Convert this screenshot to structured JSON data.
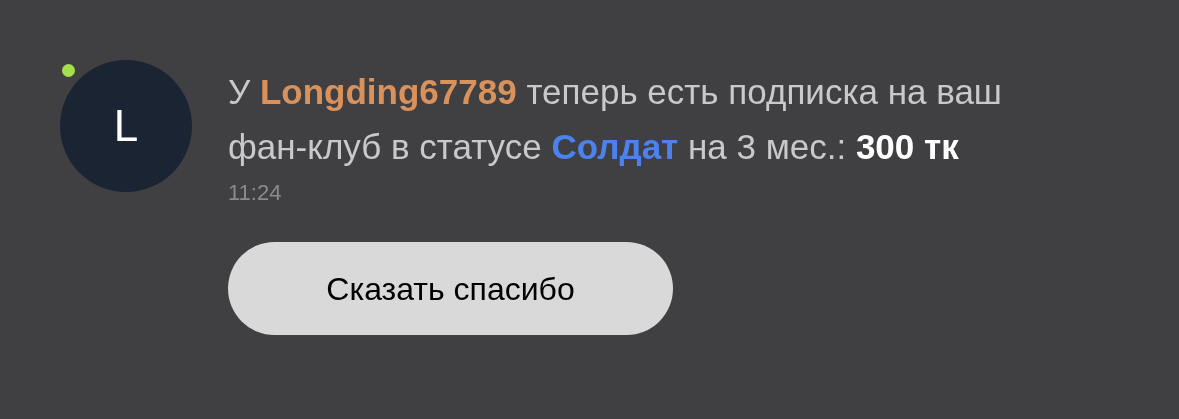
{
  "notification": {
    "avatar": {
      "letter": "L",
      "online": true
    },
    "message": [
      {
        "kind": "text",
        "text": "У "
      },
      {
        "kind": "username",
        "text": "Longding67789"
      },
      {
        "kind": "text",
        "text": " теперь есть подписка на ваш фан-клуб в статусе "
      },
      {
        "kind": "tier",
        "text": "Солдат"
      },
      {
        "kind": "text",
        "text": " на 3 мес.: "
      },
      {
        "kind": "amount",
        "text": "300 тк"
      }
    ],
    "time": "11:24",
    "button": "Сказать спасибо"
  }
}
